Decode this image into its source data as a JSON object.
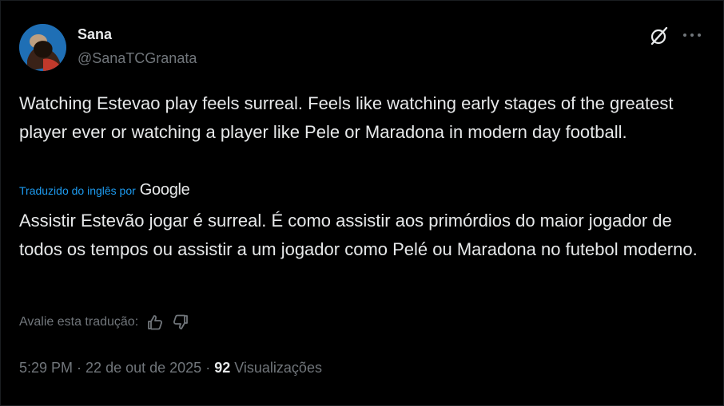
{
  "user": {
    "display_name": "Sana",
    "handle": "@SanaTCGranata"
  },
  "icons": {
    "avatar": "avatar",
    "grok": "grok-icon",
    "more": "more-icon",
    "thumbs_up": "thumbs-up-icon",
    "thumbs_down": "thumbs-down-icon"
  },
  "tweet": {
    "text": "Watching Estevao play feels surreal. Feels like watching early stages of the greatest player ever or watching a player like Pele or Maradona in modern day football."
  },
  "translation": {
    "label": "Traduzido do inglês por",
    "provider": "Google",
    "text": "Assistir Estevão jogar é surreal. É como assistir aos primórdios do maior jogador de todos os tempos ou assistir a um jogador como Pelé ou Maradona no futebol moderno.",
    "rate_label": "Avalie esta tradução:"
  },
  "meta": {
    "time": "5:29 PM",
    "sep1": " · ",
    "date": "22 de out de 2025",
    "sep2": " · ",
    "views_count": "92",
    "views_label": " Visualizações"
  },
  "colors": {
    "background": "#000000",
    "text": "#e7e9ea",
    "muted": "#71767b",
    "link": "#1d9bf0"
  }
}
